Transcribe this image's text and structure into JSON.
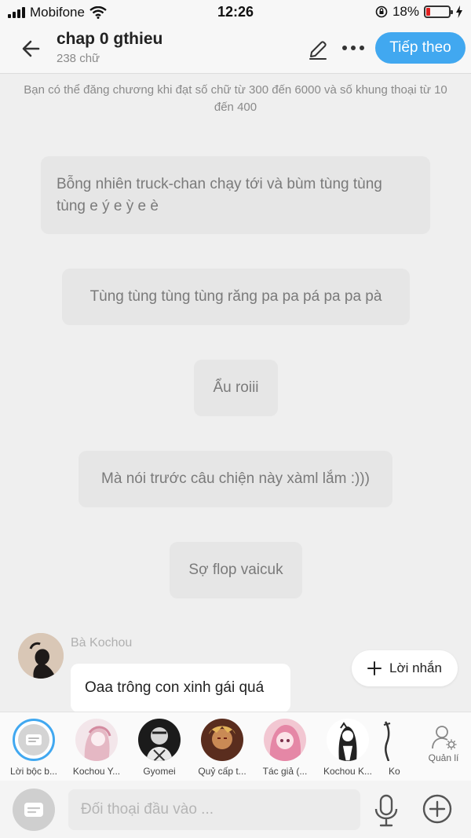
{
  "status": {
    "carrier": "Mobifone",
    "time": "12:26",
    "battery": "18%",
    "battery_level": 0.18,
    "battery_color": "#e02020"
  },
  "header": {
    "title": "chap 0 gthieu",
    "word_count": "238 chữ",
    "next_label": "Tiếp theo",
    "accent": "#41a8f0"
  },
  "notice": "Bạn có thể đăng chương khi đạt số chữ từ 300 đến 6000 và số khung thoại từ 10 đến 400",
  "narration": [
    "Bỗng nhiên truck-chan chạy tới và bùm tùng tùng tùng e ý e ỳ e è",
    "Tùng tùng tùng tùng răng pa pa pá pa pa pà",
    "Ẩu roiii",
    "Mà nói trước câu chiện này xàml lắm :)))",
    "Sợ flop vaicuk"
  ],
  "dialogue": {
    "sender": "Bà Kochou",
    "text": "Oaa trông con xinh gái quá"
  },
  "reply_button": "Lời nhắn",
  "characters": [
    {
      "name": "Lời bộc b...",
      "icon": "narrator-icon"
    },
    {
      "name": "Kochou Y...",
      "icon": "avatar"
    },
    {
      "name": "Gyomei",
      "icon": "avatar"
    },
    {
      "name": "Quỷ cấp t...",
      "icon": "avatar"
    },
    {
      "name": "Tác giả (...",
      "icon": "avatar"
    },
    {
      "name": "Kochou K...",
      "icon": "avatar"
    },
    {
      "name": "Ko",
      "icon": "avatar"
    }
  ],
  "manage_label": "Quản lí",
  "input": {
    "placeholder": "Đối thoại đầu vào ..."
  }
}
